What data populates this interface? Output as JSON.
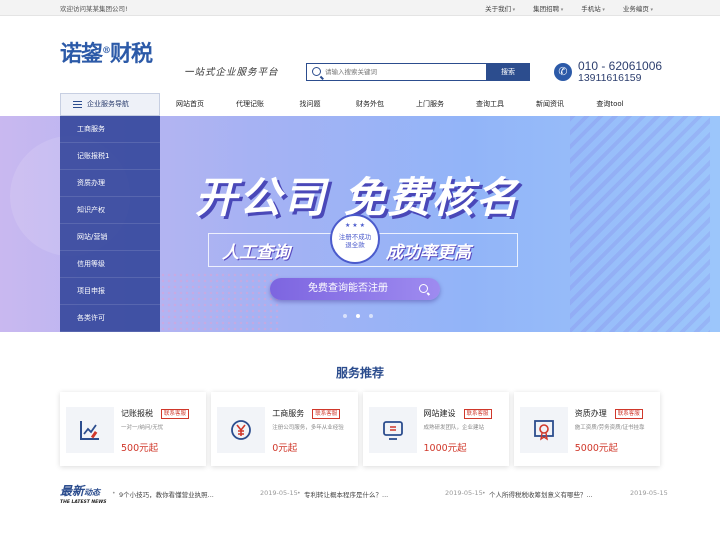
{
  "topbar": {
    "welcome": "欢迎访问某某集团公司!",
    "links": [
      "关于我们",
      "集团招聘",
      "手机站",
      "业务编页"
    ]
  },
  "header": {
    "logo_text": "诺鋆",
    "logo_reg": "®",
    "logo_suffix": "财税",
    "slogan": "一站式企业服务平台",
    "search_placeholder": "请输入搜索关键词",
    "search_button": "搜索",
    "phone_main": "010 - 62061006",
    "phone_mobile": "13911616159"
  },
  "nav": {
    "category_label": "企业服务导航",
    "items": [
      "网站首页",
      "代理记账",
      "找问题",
      "财务外包",
      "上门服务",
      "查询工具",
      "新闻资讯",
      "查询tool"
    ]
  },
  "sidemenu": [
    "工商服务",
    "记账报税1",
    "资质办理",
    "知识产权",
    "网站/营销",
    "信用等级",
    "项目申报",
    "各类许可"
  ],
  "banner": {
    "headline": "开公司 免费核名",
    "sub_left": "人工查询",
    "sub_right": "成功率更高",
    "seal_line1": "注册不成功",
    "seal_line2": "退全款",
    "cta": "免费查询能否注册"
  },
  "services": {
    "title": "服务推荐",
    "cards": [
      {
        "title": "记账报税",
        "badge": "联系客服",
        "desc": "一对一/纳问/无忧",
        "price": "500元起",
        "icon": "chart-pen-icon"
      },
      {
        "title": "工商服务",
        "badge": "联系客服",
        "desc": "注册公司服务，多年从业经验",
        "price": "0元起",
        "icon": "yen-coin-icon"
      },
      {
        "title": "网站建设",
        "badge": "联系客服",
        "desc": "成熟研发团队，企业建站",
        "price": "1000元起",
        "icon": "monitor-icon"
      },
      {
        "title": "资质办理",
        "badge": "联系客服",
        "desc": "施工资质/劳务资质/证书挂靠",
        "price": "5000元起",
        "icon": "certificate-icon"
      }
    ]
  },
  "news": {
    "logo_cn": "最新",
    "logo_cn_small": "动态",
    "logo_en": "THE LATEST NEWS",
    "items": [
      {
        "title": "9个小技巧，教你看懂营业执照...",
        "date": "2019-05-15"
      },
      {
        "title": "专利转让概本程序是什么？...",
        "date": "2019-05-15"
      },
      {
        "title": "个人所得税税收筹划意义有哪些？...",
        "date": "2019-05-15"
      }
    ]
  },
  "colors": {
    "brand": "#2c4d8e",
    "accent": "#d0382b"
  }
}
